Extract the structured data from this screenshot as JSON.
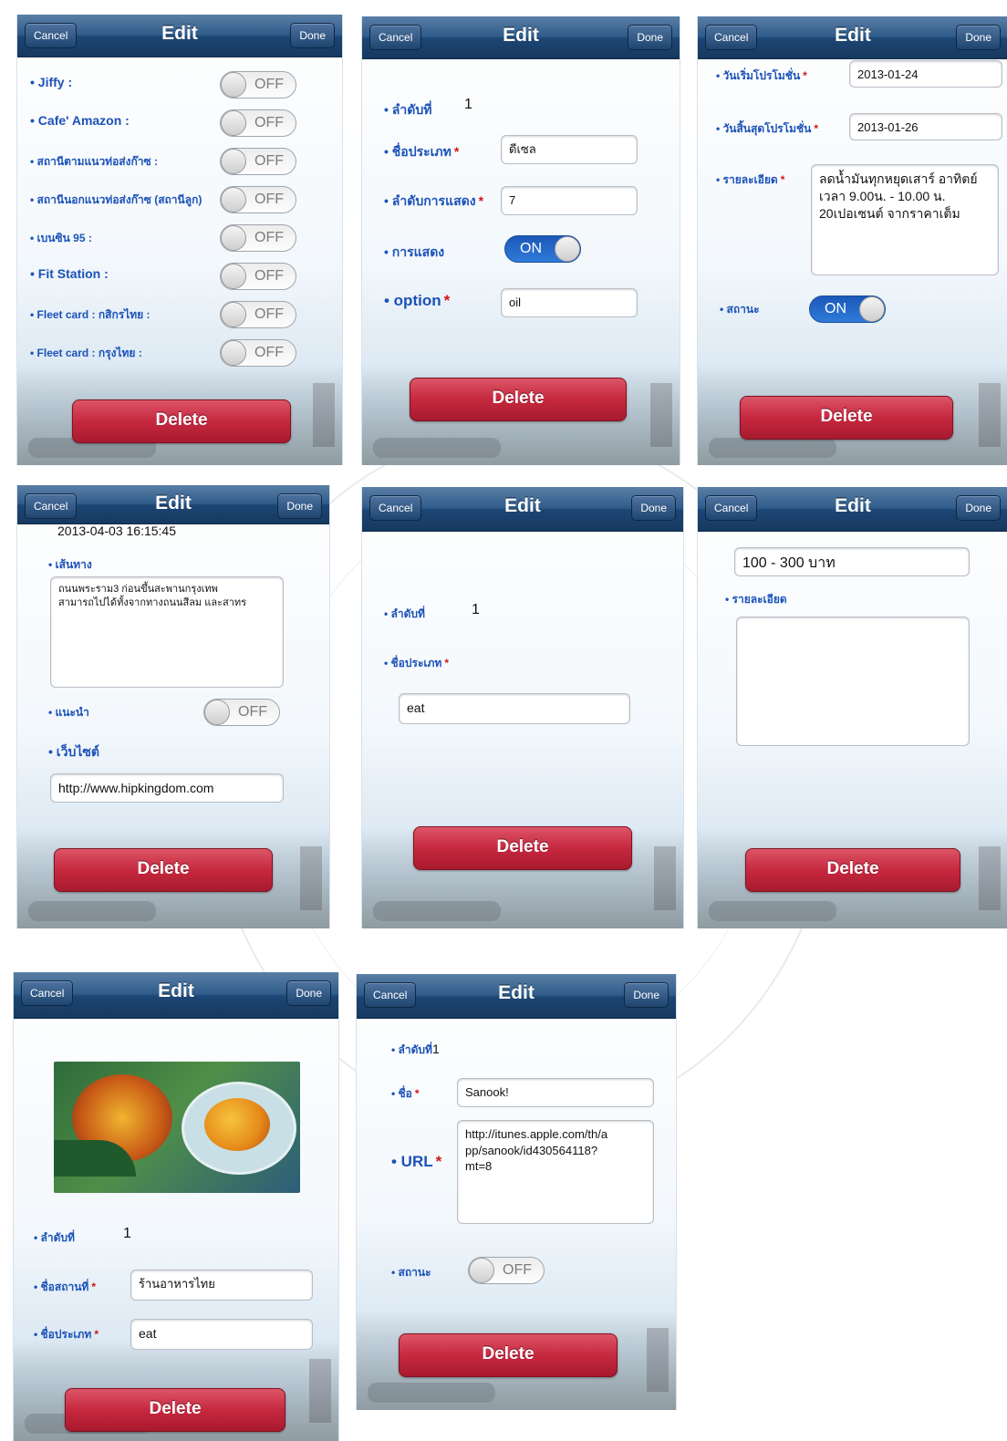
{
  "colors": {
    "navbar": "#1d4675",
    "label": "#1b52b8",
    "required": "#d01616",
    "delete": "#c6283f",
    "toggle_on": "#2f7bd9"
  },
  "icons": [
    "food-photo"
  ],
  "common": {
    "cancel": "Cancel",
    "title": "Edit",
    "done": "Done",
    "delete": "Delete",
    "required_mark": "*"
  },
  "screen1": {
    "rows": [
      {
        "label": "• Jiffy :",
        "state": "OFF"
      },
      {
        "label": "• Cafe' Amazon :",
        "state": "OFF"
      },
      {
        "label": "• สถานีตามแนวท่อส่งก๊าซ :",
        "state": "OFF"
      },
      {
        "label": "• สถานีนอกแนวท่อส่งก๊าซ (สถานีลูก)",
        "state": "OFF"
      },
      {
        "label": "• เบนซิน 95 :",
        "state": "OFF"
      },
      {
        "label": "• Fit Station :",
        "state": "OFF"
      },
      {
        "label": "• Fleet card : กสิกรไทย :",
        "state": "OFF"
      },
      {
        "label": "• Fleet card : กรุงไทย :",
        "state": "OFF"
      }
    ]
  },
  "screen2": {
    "order_label": "• ลำดับที่",
    "order_value": "1",
    "type_label": "• ชื่อประเภท",
    "type_value": "ดีเซล",
    "display_order_label": "• ลำดับการแสดง",
    "display_order_value": "7",
    "display_label": "• การแสดง",
    "display_state": "ON",
    "option_label": "• option",
    "option_value": "oil"
  },
  "screen3": {
    "start_label": "• วันเริ่มโปรโมชั่น",
    "start_value": "2013-01-24",
    "end_label": "• วันสิ้นสุดโปรโมชั่น",
    "end_value": "2013-01-26",
    "detail_label": "• รายละเอียด",
    "detail_value": "ลดน้ำมันทุกหยุดเสาร์ อาทิตย์\nเวลา 9.00น. - 10.00 น.\n20เปอเซนต์ จากราคาเต็ม",
    "status_label": "• สถานะ",
    "status_state": "ON"
  },
  "screen4": {
    "datetime": "2013-04-03 16:15:45",
    "route_label": "• เส้นทาง",
    "route_value": "ถนนพระราม3 ก่อนขึ้นสะพานกรุงเทพ\nสามารถไปได้ทั้งจากทางถนนสีลม และสาทร",
    "recommend_label": "• แนะนำ",
    "recommend_state": "OFF",
    "website_label": "• เว็บไซต์",
    "website_value": "http://www.hipkingdom.com"
  },
  "screen5": {
    "order_label": "• ลำดับที่",
    "order_value": "1",
    "type_label": "• ชื่อประเภท",
    "type_value": "eat"
  },
  "screen6": {
    "price_value": "100 - 300 บาท",
    "detail_label": "• รายละเอียด",
    "detail_value": ""
  },
  "screen7": {
    "order_label": "• ลำดับที่",
    "order_value": "1",
    "place_label": "• ชื่อสถานที่",
    "place_value": "ร้านอาหารไทย",
    "type_label": "• ชื่อประเภท",
    "type_value": "eat"
  },
  "screen8": {
    "order_label": "• ลำดับที่",
    "order_value": "1",
    "name_label": "• ชื่อ",
    "name_value": "Sanook!",
    "url_label": "• URL",
    "url_value": "http://itunes.apple.com/th/a\npp/sanook/id430564118?\nmt=8",
    "status_label": "• สถานะ",
    "status_state": "OFF"
  }
}
